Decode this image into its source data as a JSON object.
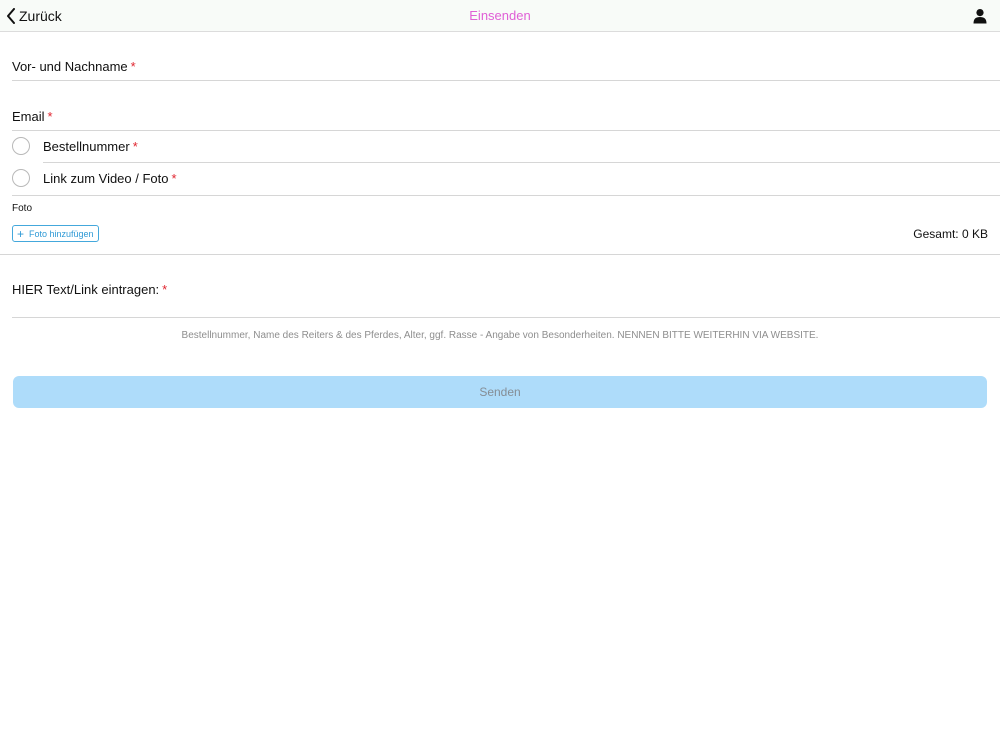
{
  "nav": {
    "back_label": "Zurück",
    "title": "Einsenden",
    "title_color": "#e05fd6",
    "user_icon": "person-icon",
    "back_icon": "chevron-left-icon"
  },
  "form": {
    "name_field": {
      "label": "Vor- und Nachname",
      "required_mark": "*",
      "value": ""
    },
    "email_field": {
      "label": "Email",
      "required_mark": "*",
      "value": ""
    },
    "radio_options": [
      {
        "label": "Bestellnummer",
        "required_mark": "*",
        "selected": false
      },
      {
        "label": "Link zum Video / Foto",
        "required_mark": "*",
        "selected": false
      }
    ],
    "photo": {
      "section_label": "Foto",
      "add_button_label": "Foto hinzufügen",
      "add_icon": "plus-icon",
      "total_size": "Gesamt: 0 KB"
    },
    "text_field": {
      "label": "HIER Text/Link eintragen:",
      "required_mark": "*",
      "value": "",
      "hint": "Bestellnummer, Name des Reiters & des Pferdes, Alter, ggf. Rasse - Angabe von Besonderheiten. NENNEN BITTE WEITERHIN VIA WEBSITE."
    },
    "submit_label": "Senden"
  },
  "colors": {
    "required": "#e0242e",
    "accent": "#44a8dc",
    "submit_bg": "#aedcfa",
    "submit_text": "#858d95"
  }
}
